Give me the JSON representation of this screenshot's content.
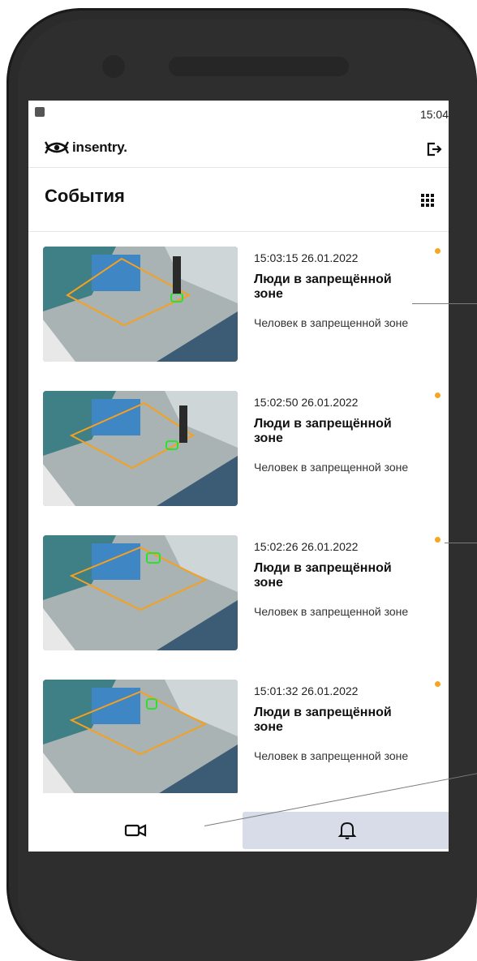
{
  "status": {
    "time": "15:04"
  },
  "header": {
    "logo_text": "insentry.",
    "logout_icon": "logout-icon"
  },
  "page": {
    "title": "События",
    "grid_icon": "grid-icon"
  },
  "events": [
    {
      "time": "15:03:15 26.01.2022",
      "title": "Люди в запрещённой зоне",
      "desc": "Человек в запрещенной зоне",
      "unread": true
    },
    {
      "time": "15:02:50 26.01.2022",
      "title": "Люди в запрещённой зоне",
      "desc": "Человек в запрещенной зоне",
      "unread": true
    },
    {
      "time": "15:02:26 26.01.2022",
      "title": "Люди в запрещённой зоне",
      "desc": "Человек в запрещенной зоне",
      "unread": true
    },
    {
      "time": "15:01:32 26.01.2022",
      "title": "Люди в запрещённой зоне",
      "desc": "Человек в запрещенной зоне",
      "unread": true
    }
  ],
  "tabs": [
    {
      "icon": "video-camera-icon",
      "active": false
    },
    {
      "icon": "bell-icon",
      "active": true
    }
  ],
  "colors": {
    "accent_dot": "#f5a623",
    "active_tab": "#d7dce8",
    "zone_outline": "#f5a01f",
    "detection": "#2ee02e"
  }
}
